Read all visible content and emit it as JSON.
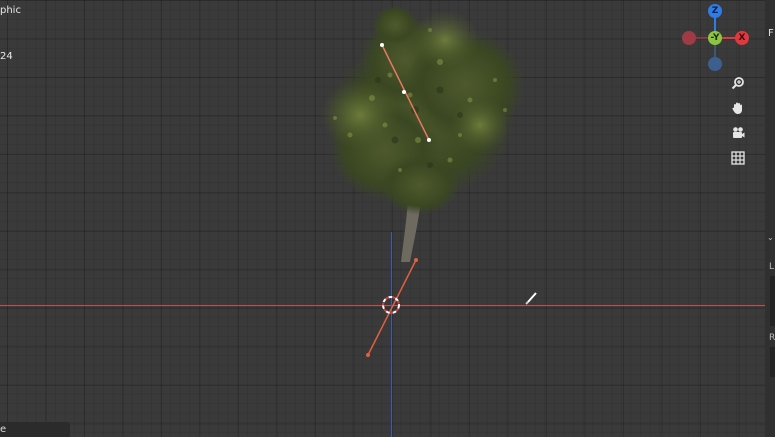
{
  "viewport": {
    "view_mode_text": "phic",
    "frame_text": "24"
  },
  "gizmo": {
    "z_label": "Z",
    "y_label": "-Y",
    "x_label": "X",
    "colors": {
      "x": "#e0383f",
      "x_neg": "#9e3b45",
      "y": "#8cc63f",
      "z": "#2f7ce6",
      "z_neg": "#3d5f8e"
    }
  },
  "navigation": {
    "tools": [
      {
        "name": "zoom-icon"
      },
      {
        "name": "pan-hand-icon"
      },
      {
        "name": "camera-icon"
      },
      {
        "name": "grid-icon"
      }
    ]
  },
  "right_panel": {
    "corner_label": "F",
    "section_l": "L",
    "section_r": "R"
  },
  "status_bar": {
    "text": "e"
  },
  "scene": {
    "object": "tree",
    "axis_colors": {
      "x": "#c0504e",
      "z": "#3b5ea8"
    },
    "handle_color": "#e06040"
  }
}
